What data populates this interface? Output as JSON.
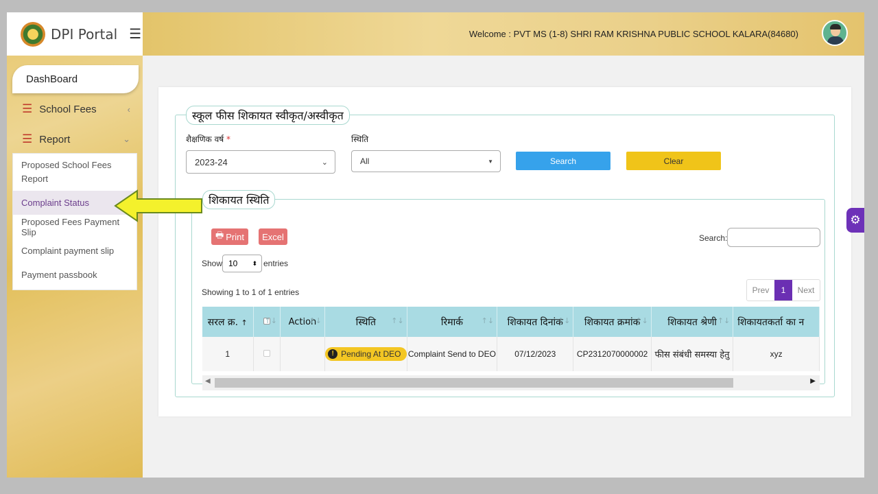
{
  "app": {
    "title": "DPI Portal",
    "welcome": "Welcome : PVT MS (1-8) SHRI RAM KRISHNA PUBLIC SCHOOL KALARA(84680)"
  },
  "icons": {
    "menu": "hamburger-icon",
    "settings": "gear-icon",
    "print": "printer-icon",
    "pending": "exclamation-icon"
  },
  "colors": {
    "sidebar_gold": "#e7c76c",
    "search_blue": "#36a2eb",
    "clear_yellow": "#f0c419",
    "pager_purple": "#6b2fb3",
    "table_header": "#a9dbe3",
    "arrow_yellow": "#f4f12c"
  },
  "sidebar": {
    "dashboard": "DashBoard",
    "school_fees": "School Fees",
    "report": "Report",
    "submenu": [
      {
        "label": "Proposed School Fees Report"
      },
      {
        "label": "Complaint Status"
      },
      {
        "label": "Proposed Fees Payment Slip"
      },
      {
        "label": "Complaint payment slip"
      },
      {
        "label": "Payment passbook"
      }
    ]
  },
  "form": {
    "legend": "स्कूल फीस शिकायत स्वीकृत/अस्वीकृत",
    "year_label": "शैक्षणिक वर्ष",
    "required_mark": "*",
    "year_value": "2023-24",
    "status_label": "स्थिति",
    "status_value": "All",
    "search": "Search",
    "clear": "Clear"
  },
  "results": {
    "legend": "शिकायत स्थिति",
    "print": "Print",
    "excel": "Excel",
    "search_label": "Search:",
    "show": "Show",
    "entries_value": "10",
    "entries": "entries",
    "info": "Showing 1 to 1 of 1 entries",
    "prev": "Prev",
    "page": "1",
    "next": "Next",
    "columns": [
      "सरल क्र.",
      "",
      "Action",
      "स्थिति",
      "रिमार्क",
      "शिकायत दिनांक",
      "शिकायत क्रमांक",
      "शिकायत श्रेणी",
      "शिकायतकर्ता का न"
    ],
    "rows": [
      {
        "sno": "1",
        "status": "Pending At DEO",
        "remark": "Complaint Send to DEO",
        "date": "07/12/2023",
        "number": "CP2312070000002",
        "category": "फीस संबंधी समस्या हेतु",
        "complainant": "xyz"
      }
    ]
  }
}
